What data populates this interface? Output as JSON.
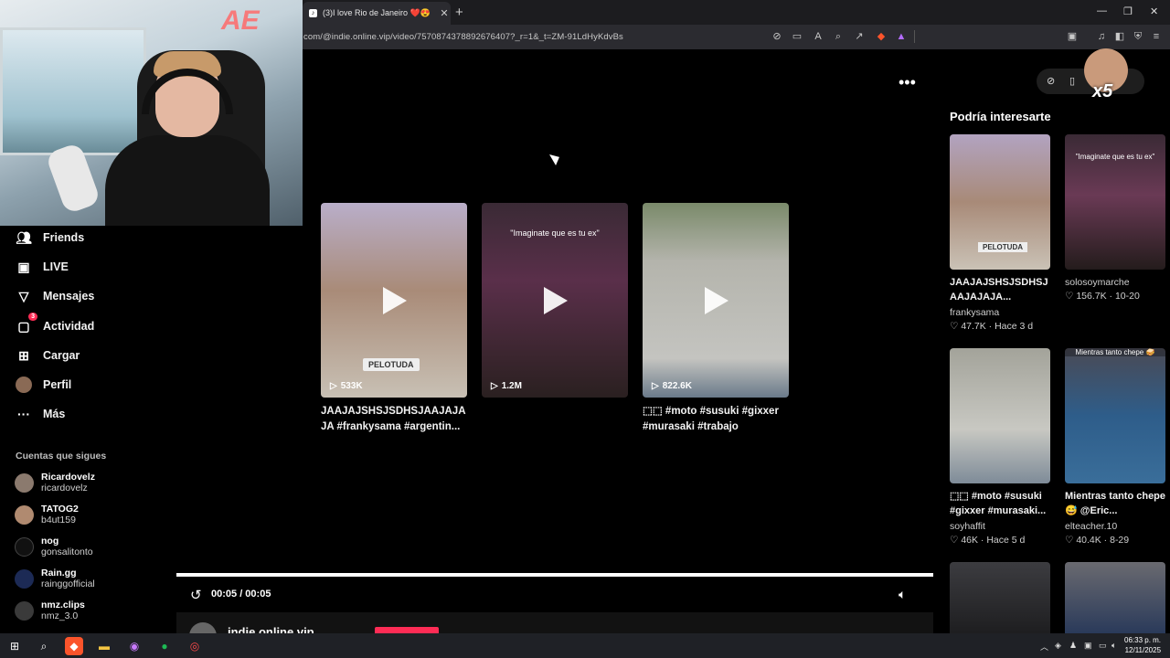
{
  "browser": {
    "tab_title": "(3)I love Rio de Janeiro ❤️😍 ...",
    "new_tab": "+",
    "url": "com/@indie.online.vip/video/7570874378892676407?_r=1&_t=ZM-91LdHyKdvBs"
  },
  "sidebar": {
    "items": [
      {
        "label": "Friends",
        "icon": "friends-icon"
      },
      {
        "label": "LIVE",
        "icon": "live-icon"
      },
      {
        "label": "Mensajes",
        "icon": "messages-icon"
      },
      {
        "label": "Actividad",
        "icon": "activity-icon",
        "badge": "3"
      },
      {
        "label": "Cargar",
        "icon": "upload-icon"
      },
      {
        "label": "Perfil",
        "icon": "profile-icon"
      },
      {
        "label": "Más",
        "icon": "more-icon"
      }
    ],
    "following_title": "Cuentas que sigues",
    "following": [
      {
        "name": "Ricardovelz",
        "handle": "ricardovelz"
      },
      {
        "name": "TATOG2",
        "handle": "b4ut159"
      },
      {
        "name": "nog",
        "handle": "gonsalitonto"
      },
      {
        "name": "Rain.gg",
        "handle": "rainggofficial"
      },
      {
        "name": "nmz.clips",
        "handle": "nmz_3.0"
      }
    ]
  },
  "main": {
    "cards": [
      {
        "views": "533K",
        "tag": "PELOTUDA",
        "overlay": "",
        "desc": "JAAJAJSHSJSDHSJAAJAJA JA #frankysama #argentin..."
      },
      {
        "views": "1.2M",
        "tag": "",
        "overlay": "\"Imaginate que es tu ex\"",
        "desc": ""
      },
      {
        "views": "822.6K",
        "tag": "",
        "overlay": "",
        "desc": "⬚⬚ #moto #susuki #gixxer #murasaki #trabajo"
      }
    ],
    "time": "00:05 / 00:05",
    "progress": 1.0,
    "author": "indie.online.vip"
  },
  "right": {
    "title": "Podría interesarte",
    "x5_label": "x5",
    "items": [
      {
        "title": "JAAJAJSHSJSDHSJ AAJAJAJA...",
        "author": "frankysama",
        "stats": "♡ 47.7K · Hace 3 d",
        "tag": "PELOTUDA",
        "overlay": ""
      },
      {
        "title": "",
        "author": "solosoymarche",
        "stats": "♡ 156.7K · 10-20",
        "tag": "",
        "overlay": "\"Imaginate que es tu ex\""
      },
      {
        "title": "⬚⬚ #moto #susuki #gixxer #murasaki...",
        "author": "soyhaffit",
        "stats": "♡ 46K · Hace 5 d",
        "tag": "",
        "overlay": ""
      },
      {
        "title": "Mientras tanto chepe 😅 @Eric...",
        "author": "elteacher.10",
        "stats": "♡ 40.4K · 8-29",
        "tag": "",
        "overlay": "Mientras tanto chepe 🥪"
      }
    ]
  },
  "taskbar": {
    "time": "06:33 p. m.",
    "date": "12/11/2025"
  }
}
